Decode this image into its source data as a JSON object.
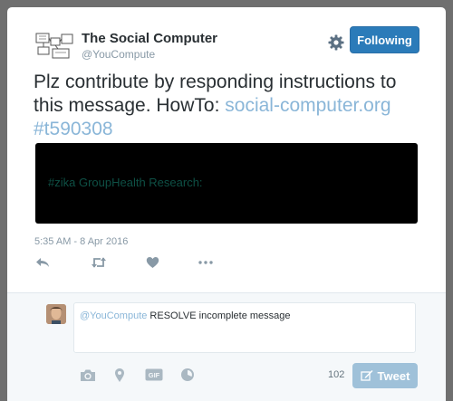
{
  "profile": {
    "display_name": "The Social Computer",
    "handle": "@YouCompute",
    "follow_label": "Following"
  },
  "tweet": {
    "text_plain": "Plz contribute by responding instructions to this message. HowTo: ",
    "link_text": "social-computer.org",
    "hashtag": "#t590308",
    "media_text": "#zika GroupHealth Research:",
    "timestamp": "5:35 AM - 8 Apr 2016"
  },
  "actions": {
    "icons": [
      "reply-icon",
      "retweet-icon",
      "like-icon",
      "more-icon"
    ]
  },
  "reply": {
    "mention": "@YouCompute",
    "text": " RESOLVE incomplete message",
    "char_count": "102",
    "tweet_label": "Tweet",
    "tools": [
      "camera-icon",
      "location-icon",
      "gif-icon",
      "poll-icon"
    ]
  },
  "colors": {
    "accent": "#2b7bb9",
    "link": "#8ab6d8",
    "tweet_button_disabled": "#9fc1d9",
    "muted": "#8899a6"
  }
}
